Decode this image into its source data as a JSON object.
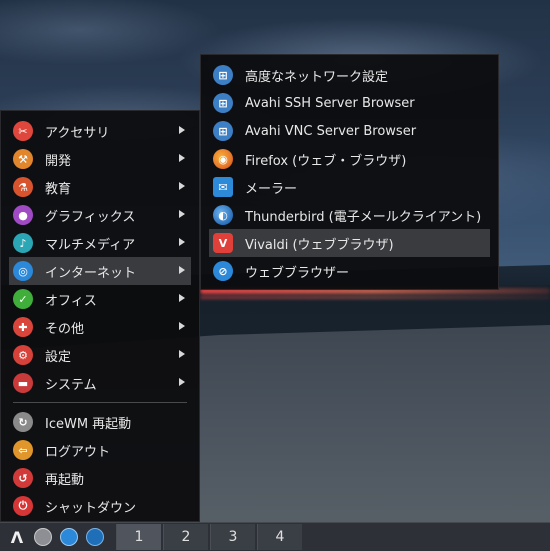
{
  "main_menu": {
    "items": [
      {
        "label": "アクセサリ",
        "icon": "accessories-icon",
        "color": "#e0473c",
        "submenu": true
      },
      {
        "label": "開発",
        "icon": "development-icon",
        "color": "#e2862d",
        "submenu": true
      },
      {
        "label": "教育",
        "icon": "education-icon",
        "color": "#d8542e",
        "submenu": true
      },
      {
        "label": "グラフィックス",
        "icon": "graphics-icon",
        "color": "#a04bc4",
        "submenu": true
      },
      {
        "label": "マルチメディア",
        "icon": "multimedia-icon",
        "color": "#2aa6b4",
        "submenu": true
      },
      {
        "label": "インターネット",
        "icon": "internet-icon",
        "color": "#2c88d9",
        "submenu": true,
        "active": true
      },
      {
        "label": "オフィス",
        "icon": "office-icon",
        "color": "#3fae3a",
        "submenu": true
      },
      {
        "label": "その他",
        "icon": "other-icon",
        "color": "#d9453a",
        "submenu": true
      },
      {
        "label": "設定",
        "icon": "settings-icon",
        "color": "#d6413a",
        "submenu": true
      },
      {
        "label": "システム",
        "icon": "system-icon",
        "color": "#c93a3a",
        "submenu": true
      }
    ],
    "actions": [
      {
        "label": "IceWM 再起動",
        "icon": "restart-wm-icon",
        "color": "#8a8a8a"
      },
      {
        "label": "ログアウト",
        "icon": "logout-icon",
        "color": "#e0962a"
      },
      {
        "label": "再起動",
        "icon": "reboot-icon",
        "color": "#d23a3a"
      },
      {
        "label": "シャットダウン",
        "icon": "shutdown-icon",
        "color": "#d63636"
      }
    ]
  },
  "sub_menu": {
    "items": [
      {
        "label": "高度なネットワーク設定",
        "icon": "network-icon",
        "color": "#3d7fc4"
      },
      {
        "label": "Avahi SSH Server Browser",
        "icon": "network-icon",
        "color": "#3d7fc4"
      },
      {
        "label": "Avahi VNC Server Browser",
        "icon": "network-icon",
        "color": "#3d7fc4"
      },
      {
        "label": "Firefox (ウェブ・ブラウザ)",
        "icon": "firefox-icon",
        "color": "#e8772a"
      },
      {
        "label": "メーラー",
        "icon": "mailer-icon",
        "color": "#2c8ad9"
      },
      {
        "label": "Thunderbird (電子メールクライアント)",
        "icon": "thunderbird-icon",
        "color": "#2a6fb8"
      },
      {
        "label": "Vivaldi (ウェブブラウザ)",
        "icon": "vivaldi-icon",
        "color": "#e0403a",
        "active": true
      },
      {
        "label": "ウェブブラウザー",
        "icon": "web-browser-icon",
        "color": "#2c88d9"
      }
    ]
  },
  "taskbar": {
    "start_glyph": "Λ",
    "tray": [
      "system-monitor-icon",
      "browser-icon",
      "file-manager-icon"
    ],
    "workspaces": [
      "1",
      "2",
      "3",
      "4"
    ]
  }
}
